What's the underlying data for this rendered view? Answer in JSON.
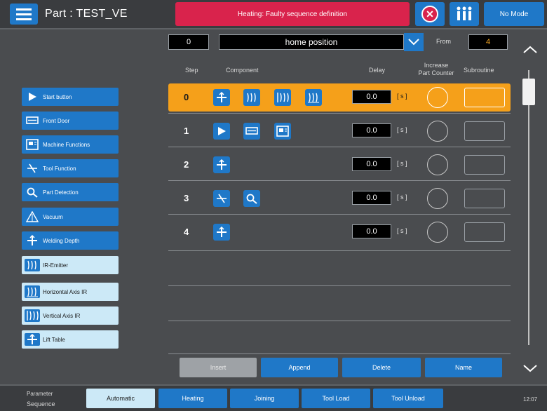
{
  "header": {
    "part_title": "Part : TEST_VE",
    "alarm_text": "Heating: Faulty sequence definition",
    "mode_label": "No Mode",
    "menu_icon": "hamburger-icon",
    "error_icon": "close-circle-icon",
    "machine_icon": "machine-status-icon"
  },
  "sequence_header": {
    "step_value": "0",
    "position_name": "home position",
    "from_label": "From",
    "from_value": "4"
  },
  "columns": {
    "step": "Step",
    "component": "Component",
    "delay": "Delay",
    "increase_line1": "Increase",
    "increase_line2": "Part Counter",
    "subroutine": "Subroutine"
  },
  "components": [
    {
      "label": "Start button",
      "icon": "play-icon",
      "style": "dark"
    },
    {
      "label": "Front Door",
      "icon": "door-icon",
      "style": "dark"
    },
    {
      "label": "Machine Functions",
      "icon": "machine-functions-icon",
      "style": "dark"
    },
    {
      "label": "Tool Function",
      "icon": "tool-function-icon",
      "style": "dark"
    },
    {
      "label": "Part Detection",
      "icon": "part-detection-icon",
      "style": "dark"
    },
    {
      "label": "Vacuum",
      "icon": "vacuum-icon",
      "style": "dark"
    },
    {
      "label": "Welding Depth",
      "icon": "welding-depth-icon",
      "style": "dark"
    },
    {
      "label": "IR-Emitter",
      "icon": "ir-emitter-icon",
      "style": "light"
    },
    {
      "label": "Horizontal Axis IR",
      "icon": "horizontal-axis-ir-icon",
      "style": "light"
    },
    {
      "label": "Vertical Axis IR",
      "icon": "vertical-axis-ir-icon",
      "style": "light"
    },
    {
      "label": "Lift Table",
      "icon": "lift-table-icon",
      "style": "light"
    }
  ],
  "steps": [
    {
      "step": "0",
      "icons": [
        "lift-table-icon",
        "ir-emitter-icon",
        "vertical-axis-ir-icon",
        "horizontal-axis-ir-icon"
      ],
      "delay": "0.0",
      "unit": "[ s ]",
      "active": true
    },
    {
      "step": "1",
      "icons": [
        "play-icon",
        "door-icon",
        "machine-functions-icon"
      ],
      "delay": "0.0",
      "unit": "[ s ]",
      "active": false
    },
    {
      "step": "2",
      "icons": [
        "lift-table-icon"
      ],
      "delay": "0.0",
      "unit": "[ s ]",
      "active": false
    },
    {
      "step": "3",
      "icons": [
        "tool-function-icon",
        "part-detection-icon"
      ],
      "delay": "0.0",
      "unit": "[ s ]",
      "active": false
    },
    {
      "step": "4",
      "icons": [
        "lift-table-icon"
      ],
      "delay": "0.0",
      "unit": "[ s ]",
      "active": false
    }
  ],
  "actions": {
    "insert": "Insert",
    "append": "Append",
    "delete": "Delete",
    "name": "Name"
  },
  "footer": {
    "parameter_label": "Parameter",
    "sequence_label": "Sequence",
    "tabs": [
      "Automatic",
      "Heating",
      "Joining",
      "Tool Load",
      "Tool Unload"
    ],
    "time": "12:07"
  },
  "colors": {
    "accent_blue": "#1f78c8",
    "active_row": "#f5a01a",
    "alarm_red": "#d9234c",
    "light_button": "#cce9f7"
  }
}
